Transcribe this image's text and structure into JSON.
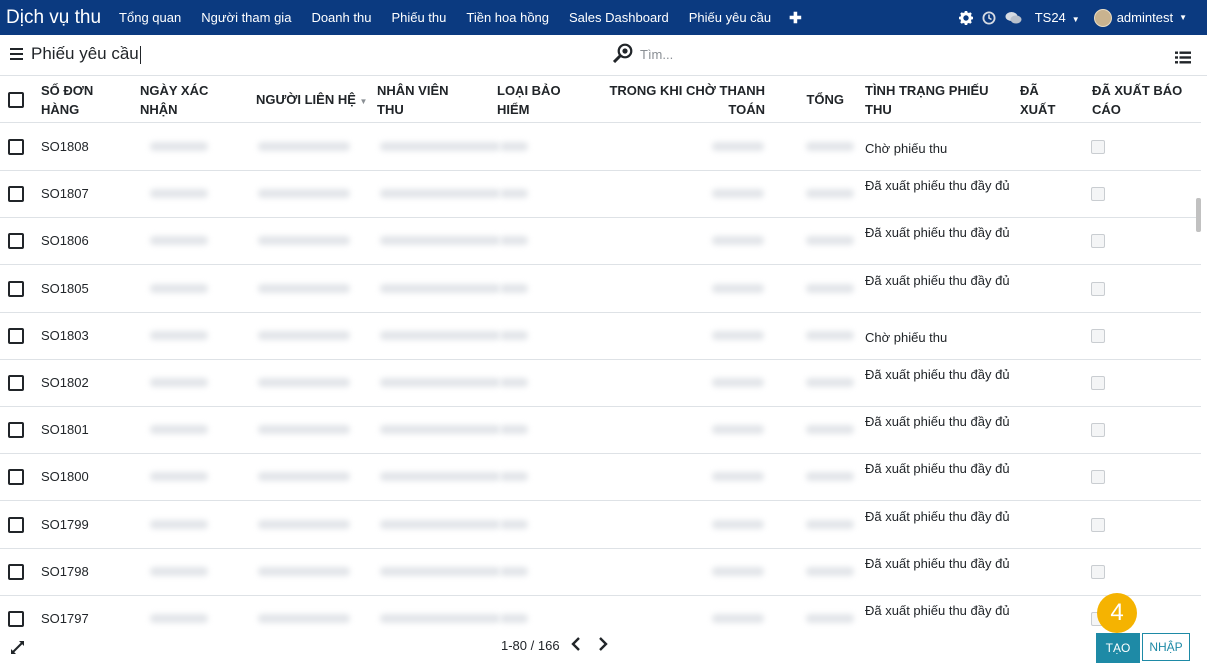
{
  "navbar": {
    "brand": "Dịch vụ thu",
    "menu": [
      "Tổng quan",
      "Người tham gia",
      "Doanh thu",
      "Phiếu thu",
      "Tiền hoa hồng",
      "Sales Dashboard",
      "Phiếu yêu cầu"
    ],
    "company": "TS24",
    "user": "admintest"
  },
  "controlbar": {
    "breadcrumb": "Phiếu yêu cầu",
    "search_placeholder": "Tìm..."
  },
  "table": {
    "headers": {
      "order": [
        "Số đơn",
        "hàng"
      ],
      "confirm_date": [
        "Ngày xác",
        "nhận"
      ],
      "contact": [
        "Người liên hệ"
      ],
      "staff": [
        "Nhân viên",
        "thu"
      ],
      "insurance": [
        "Loại bảo",
        "hiểm"
      ],
      "pending": [
        "Trong khi chờ thanh",
        "toán"
      ],
      "total": [
        "Tổng"
      ],
      "status": [
        "Tình trạng phiếu",
        "thu"
      ],
      "exported": [
        "Đã",
        "xuất"
      ],
      "reported": [
        "Đã xuất báo",
        "cáo"
      ]
    },
    "rows": [
      {
        "order": "SO1808",
        "status": "Chờ phiếu thu"
      },
      {
        "order": "SO1807",
        "status": "Đã xuất phiếu thu đầy đủ"
      },
      {
        "order": "SO1806",
        "status": "Đã xuất phiếu thu đầy đủ"
      },
      {
        "order": "SO1805",
        "status": "Đã xuất phiếu thu đầy đủ"
      },
      {
        "order": "SO1803",
        "status": "Chờ phiếu thu"
      },
      {
        "order": "SO1802",
        "status": "Đã xuất phiếu thu đầy đủ"
      },
      {
        "order": "SO1801",
        "status": "Đã xuất phiếu thu đầy đủ"
      },
      {
        "order": "SO1800",
        "status": "Đã xuất phiếu thu đầy đủ"
      },
      {
        "order": "SO1799",
        "status": "Đã xuất phiếu thu đầy đủ"
      },
      {
        "order": "SO1798",
        "status": "Đã xuất phiếu thu đầy đủ"
      },
      {
        "order": "SO1797",
        "status": "Đã xuất phiếu thu đầy đủ"
      }
    ]
  },
  "footer": {
    "pager": "1-80 / 166",
    "create_label": "TẠO",
    "import_label": "NHẬP"
  },
  "step_badge": "4",
  "colors": {
    "navbar": "#0b3a80",
    "primary_button": "#1e8aa6",
    "badge": "#f5b301"
  },
  "icons": [
    "gear-icon",
    "clock-icon",
    "chat-icon",
    "hamburger-icon",
    "search-icon",
    "list-view-icon",
    "expand-icon",
    "chevron-left-icon",
    "chevron-right-icon",
    "plus-icon",
    "sort-caret-icon"
  ]
}
